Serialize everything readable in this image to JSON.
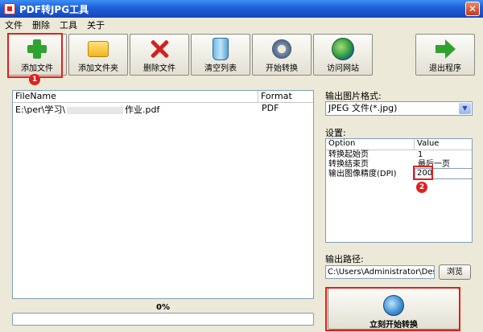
{
  "window": {
    "title": "PDF转JPG工具",
    "close_glyph": "✕"
  },
  "menu": [
    "文件",
    "删除",
    "工具",
    "关于"
  ],
  "toolbar": {
    "add_file": "添加文件",
    "add_folder": "添加文件夹",
    "delete_file": "删除文件",
    "clear_list": "清空列表",
    "start_convert": "开始转换",
    "visit_site": "访问网站",
    "exit_program": "退出程序"
  },
  "file_list": {
    "columns": [
      "FileName",
      "Format"
    ],
    "rows": [
      {
        "name_prefix": "E:\\per\\学习\\",
        "name_suffix": "作业.pdf",
        "format": "PDF"
      }
    ]
  },
  "progress": {
    "label": "0%",
    "value": 0
  },
  "output_format": {
    "label": "输出图片格式:",
    "selected": "JPEG 文件(*.jpg)",
    "arrow": "▼"
  },
  "settings": {
    "label": "设置:",
    "columns": [
      "Option",
      "Value"
    ],
    "rows": [
      {
        "option": "转换起始页",
        "value": "1"
      },
      {
        "option": "转换结束页",
        "value": "最后一页"
      },
      {
        "option": "输出图像精度(DPI)",
        "value": "200"
      }
    ]
  },
  "output_path": {
    "label": "输出路径:",
    "value": "C:\\Users\\Administrator\\Deskt",
    "browse": "浏览"
  },
  "start_button": {
    "label": "立刻开始转换"
  },
  "annotations": {
    "badge1": "1",
    "badge2": "2",
    "color": "#e0201c"
  }
}
